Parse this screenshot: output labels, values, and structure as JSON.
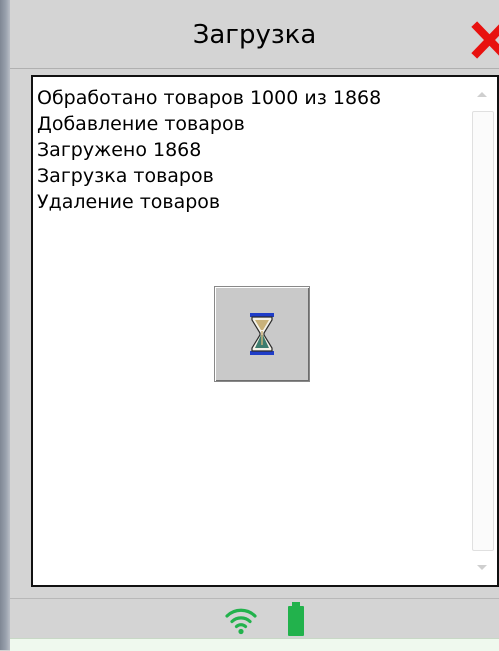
{
  "window": {
    "title": "Загрузка"
  },
  "log": {
    "lines": [
      "Обработано товаров 1000 из 1868",
      "Добавление товаров",
      "Загружено 1868",
      "Загрузка товаров",
      "Удаление товаров"
    ]
  },
  "icons": {
    "close": "close-icon",
    "busy": "hourglass-icon",
    "wifi": "wifi-icon",
    "battery": "battery-icon"
  },
  "colors": {
    "close": "#e8110f",
    "status_icons": "#22b24c",
    "hourglass_frame": "#1e3cc8"
  }
}
